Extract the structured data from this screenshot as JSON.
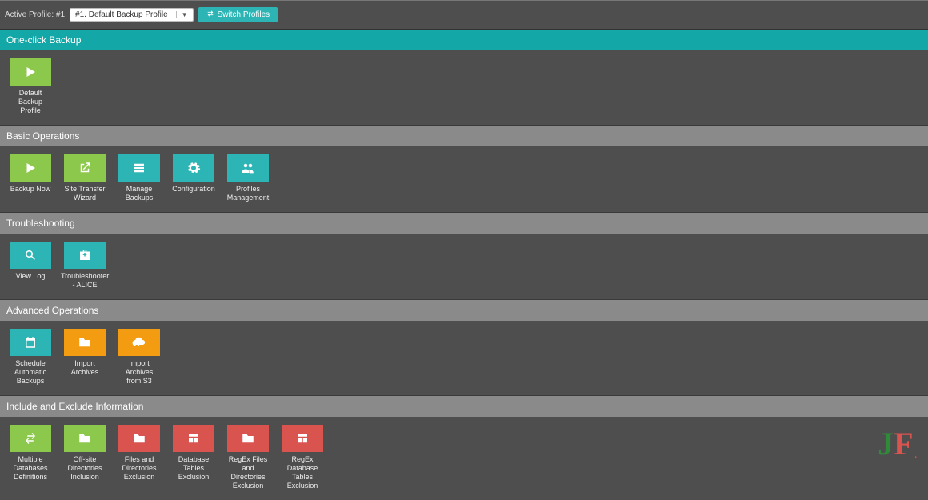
{
  "topbar": {
    "active_profile_label": "Active Profile: #1",
    "profile_selected": "#1. Default Backup Profile",
    "switch_label": "Switch Profiles"
  },
  "sections": {
    "oneclick": {
      "title": "One-click Backup",
      "tiles": [
        {
          "id": "default-backup-profile",
          "color": "c-green",
          "icon": "play",
          "label": "Default Backup Profile"
        }
      ]
    },
    "basic": {
      "title": "Basic Operations",
      "tiles": [
        {
          "id": "backup-now",
          "color": "c-green",
          "icon": "play",
          "label": "Backup Now"
        },
        {
          "id": "site-transfer-wizard",
          "color": "c-green",
          "icon": "external",
          "label": "Site Transfer Wizard"
        },
        {
          "id": "manage-backups",
          "color": "c-teal",
          "icon": "list",
          "label": "Manage Backups"
        },
        {
          "id": "configuration",
          "color": "c-teal",
          "icon": "gear",
          "label": "Configuration"
        },
        {
          "id": "profiles-management",
          "color": "c-teal",
          "icon": "users",
          "label": "Profiles Management"
        }
      ]
    },
    "trouble": {
      "title": "Troubleshooting",
      "tiles": [
        {
          "id": "view-log",
          "color": "c-teal",
          "icon": "search",
          "label": "View Log"
        },
        {
          "id": "troubleshooter-alice",
          "color": "c-teal",
          "icon": "medkit",
          "label": "Troubleshooter - ALICE"
        }
      ]
    },
    "advanced": {
      "title": "Advanced Operations",
      "tiles": [
        {
          "id": "schedule-automatic-backups",
          "color": "c-teal",
          "icon": "calendar",
          "label": "Schedule Automatic Backups"
        },
        {
          "id": "import-archives",
          "color": "c-orange",
          "icon": "folder",
          "label": "Import Archives"
        },
        {
          "id": "import-archives-from-s3",
          "color": "c-orange",
          "icon": "cloud-down",
          "label": "Import Archives from S3"
        }
      ]
    },
    "include": {
      "title": "Include and Exclude Information",
      "tiles": [
        {
          "id": "multiple-db-definitions",
          "color": "c-green",
          "icon": "swap",
          "label": "Multiple Databases Definitions"
        },
        {
          "id": "offsite-dir-inclusion",
          "color": "c-green",
          "icon": "folder",
          "label": "Off-site Directories Inclusion"
        },
        {
          "id": "files-dir-exclusion",
          "color": "c-red",
          "icon": "folder",
          "label": "Files and Directories Exclusion"
        },
        {
          "id": "db-tables-exclusion",
          "color": "c-red",
          "icon": "table",
          "label": "Database Tables Exclusion"
        },
        {
          "id": "regex-files-dir-exclusion",
          "color": "c-red",
          "icon": "folder",
          "label": "RegEx Files and Directories Exclusion"
        },
        {
          "id": "regex-db-tables-exclusion",
          "color": "c-red",
          "icon": "table",
          "label": "RegEx Database Tables Exclusion"
        }
      ]
    }
  },
  "logo": {
    "j": "J",
    "f": "F",
    "dot": "."
  }
}
